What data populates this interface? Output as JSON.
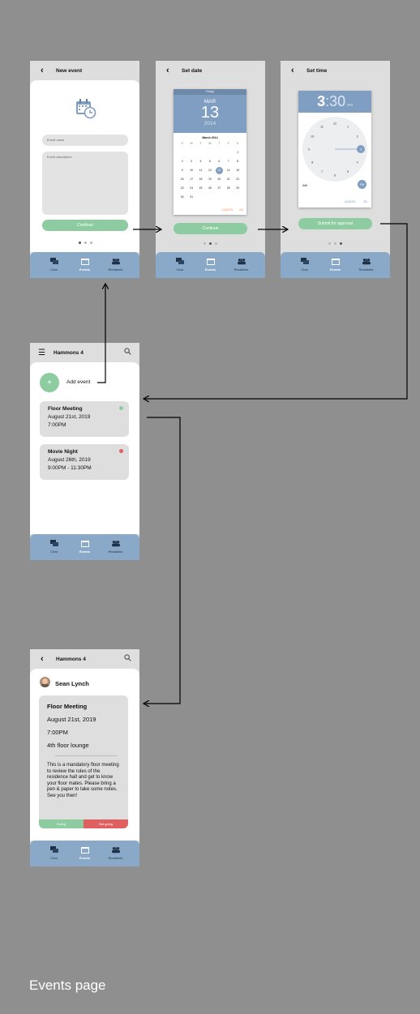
{
  "colors": {
    "background": "#8f8f8f",
    "nav": "#8aa9c8",
    "accent_blue": "#7f9ec1",
    "green": "#8ccca0",
    "red": "#e06060",
    "card": "#dedede",
    "cancel_orange": "#f0905a"
  },
  "nav": {
    "chat": "Chat",
    "events": "Events",
    "residents": "Residents"
  },
  "new_event": {
    "title": "New event",
    "name_placeholder": "Event name",
    "description_placeholder": "Event description",
    "continue": "Continue"
  },
  "set_date": {
    "title": "Set date",
    "day": "Friday",
    "month": "MAR",
    "date": "13",
    "year": "2014",
    "month_label": "March 2014",
    "weekdays": [
      "S",
      "M",
      "T",
      "W",
      "T",
      "F",
      "S"
    ],
    "rows": [
      [
        "",
        "",
        "",
        "",
        "",
        "",
        "1"
      ],
      [
        "2",
        "3",
        "4",
        "5",
        "6",
        "7",
        "8"
      ],
      [
        "9",
        "10",
        "11",
        "12",
        "13",
        "14",
        "15"
      ],
      [
        "16",
        "17",
        "18",
        "19",
        "20",
        "21",
        "22"
      ],
      [
        "23",
        "24",
        "25",
        "26",
        "27",
        "28",
        "29"
      ],
      [
        "30",
        "31",
        "",
        "",
        "",
        "",
        ""
      ]
    ],
    "selected": "13",
    "cancel": "CANCEL",
    "ok": "OK",
    "continue": "Continue"
  },
  "set_time": {
    "title": "Set time",
    "hour": "3",
    "minute": ":30",
    "ampm": "PM",
    "clock_numbers": [
      "12",
      "1",
      "2",
      "3",
      "4",
      "5",
      "6",
      "7",
      "8",
      "9",
      "10",
      "11"
    ],
    "am": "AM",
    "pm": "PM",
    "cancel": "CANCEL",
    "ok": "OK",
    "submit": "Submit for approval"
  },
  "events_list": {
    "title": "Hammons 4",
    "add_event": "Add event",
    "add_symbol": "+",
    "events": [
      {
        "name": "Floor Meeting",
        "date": "August 21st, 2019",
        "time": "7:00PM",
        "status": "green"
      },
      {
        "name": "Movie Night",
        "date": "August 26th, 2019",
        "time": "9:00PM - 11:30PM",
        "status": "red"
      }
    ]
  },
  "event_detail": {
    "title": "Hammons 4",
    "user": "Sean Lynch",
    "event_name": "Floor Meeting",
    "date": "August 21st, 2019",
    "time": "7:00PM",
    "location": "4th floor lounge",
    "description": "This is a mandatory floor meeting to review the rules of the residence hall and get to know your floor mates. Please bring a pen & paper to take some notes. See you then!",
    "going": "Going",
    "not_going": "Not going"
  },
  "caption": "Events page"
}
